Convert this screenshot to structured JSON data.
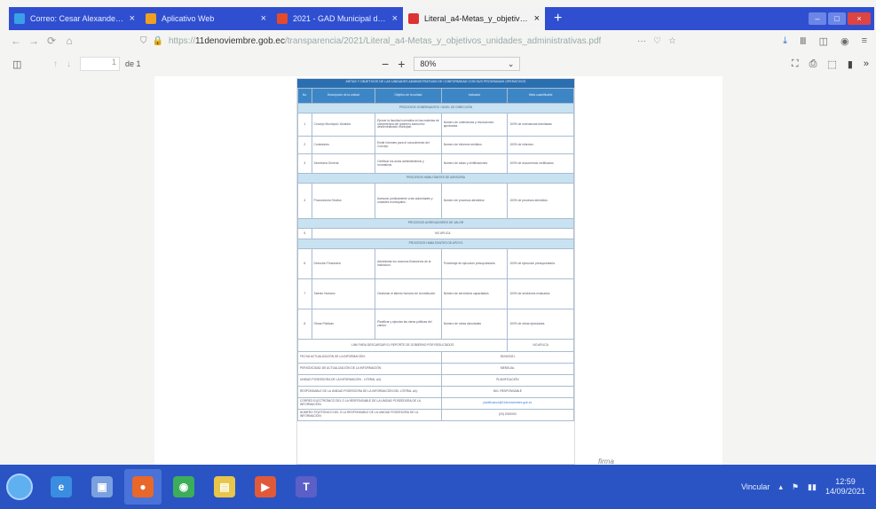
{
  "tabs": [
    {
      "title": "Correo: Cesar Alexander Grijalva",
      "active": false,
      "favicon_color": "#3aa0e8"
    },
    {
      "title": "Aplicativo Web",
      "active": false,
      "favicon_color": "#f0a020"
    },
    {
      "title": "2021 - GAD Municipal de 11 de",
      "active": false,
      "favicon_color": "#e34b2b"
    },
    {
      "title": "Literal_a4-Metas_y_objetivos_unid",
      "active": true,
      "favicon_color": "#d33"
    }
  ],
  "url": {
    "host": "11denoviembre.gob.ec",
    "path": "/transparencia/2021/Literal_a4-Metas_y_objetivos_unidades_administrativas.pdf"
  },
  "pdf": {
    "page_number": "1",
    "page_count": "de 1",
    "zoom": "80%"
  },
  "document": {
    "header": "METAS Y OBJETIVOS DE LAS UNIDADES ADMINISTRATIVAS DE CONFORMIDAD CON SUS PROGRAMAS OPERATIVOS",
    "columns": [
      "No.",
      "Descripción de la unidad",
      "Objetivo de la unidad",
      "Indicador",
      "Meta cuantificable"
    ],
    "sections": [
      {
        "title": "PROCESOS GOBERNANTES / NIVEL DE DIRECCIÓN",
        "rows": [
          {
            "num": "1",
            "unit": "Concejo Municipal / Alcaldía",
            "objective": "Ejercer la facultad normativa en las materias de competencia del gobierno autónomo descentralizado municipal.",
            "indicator": "Número de ordenanzas y resoluciones aprobadas",
            "goal": "100% de ordenanzas tramitadas"
          },
          {
            "num": "2",
            "unit": "Comisiones",
            "objective": "Emitir informes para el conocimiento del Concejo.",
            "indicator": "Número de informes emitidos",
            "goal": "100% de informes"
          },
          {
            "num": "3",
            "unit": "Secretaría General",
            "objective": "Certificar los actos administrativos y normativos.",
            "indicator": "Número de actas y certificaciones",
            "goal": "100% de documentos certificados"
          }
        ]
      },
      {
        "title": "PROCESOS HABILITANTES DE ASESORÍA",
        "rows": [
          {
            "num": "4",
            "unit": "Procuraduría Síndica",
            "objective": "Asesorar jurídicamente a las autoridades y unidades municipales.",
            "indicator": "Número de procesos atendidos",
            "goal": "100% de procesos atendidos"
          }
        ]
      },
      {
        "title": "PROCESOS AGREGADORES DE VALOR",
        "rows": [
          {
            "num": "5",
            "unit": "",
            "objective": "NO APLICA",
            "indicator": "",
            "goal": ""
          }
        ]
      },
      {
        "title": "PROCESOS HABILITANTES DE APOYO",
        "rows": [
          {
            "num": "6",
            "unit": "Dirección Financiera",
            "objective": "Administrar los recursos financieros de la institución.",
            "indicator": "Porcentaje de ejecución presupuestaria",
            "goal": "100% de ejecución presupuestaria"
          },
          {
            "num": "7",
            "unit": "Talento Humano",
            "objective": "Gestionar el talento humano de la institución.",
            "indicator": "Número de servidores capacitados",
            "goal": "100% de servidores evaluados"
          },
          {
            "num": "8",
            "unit": "Obras Públicas",
            "objective": "Planificar y ejecutar las obras públicas del cantón.",
            "indicator": "Número de obras ejecutadas",
            "goal": "100% de obras ejecutadas"
          }
        ]
      }
    ],
    "report_note": "LINK PARA DESCARGAR EL REPORTE DE GOBIERNO POR RESULTADOS",
    "report_value": "NO APLICA",
    "footer_rows": [
      {
        "label": "FECHA ACTUALIZACIÓN DE LA INFORMACIÓN:",
        "value": "30/06/2021"
      },
      {
        "label": "PERIODICIDAD DE ACTUALIZACIÓN DE LA INFORMACIÓN:",
        "value": "MENSUAL"
      },
      {
        "label": "UNIDAD POSEEDORA DE LA INFORMACIÓN - LITERAL a4):",
        "value": "PLANIFICACIÓN"
      },
      {
        "label": "RESPONSABLE DE LA UNIDAD POSEEDORA DE LA INFORMACIÓN DEL LITERAL a4):",
        "value": "ING. RESPONSABLE"
      },
      {
        "label": "CORREO ELECTRÓNICO DEL O LA RESPONSABLE DE LA UNIDAD POSEEDORA DE LA INFORMACIÓN:",
        "value": "planificacion@11denoviembre.gob.ec"
      },
      {
        "label": "NÚMERO TELEFÓNICO DEL O LA RESPONSABLE DE LA UNIDAD POSEEDORA DE LA INFORMACIÓN:",
        "value": "(03) 2000000"
      }
    ],
    "signature": "firma"
  },
  "taskbar": {
    "apps": [
      {
        "name": "ie",
        "label": "e",
        "color": "#3a8de0",
        "active": false
      },
      {
        "name": "explorer-window",
        "label": "▣",
        "color": "#7aa0e0",
        "active": false
      },
      {
        "name": "firefox",
        "label": "●",
        "color": "#e8672a",
        "active": true
      },
      {
        "name": "chrome",
        "label": "◉",
        "color": "#3cae5a",
        "active": false
      },
      {
        "name": "folder",
        "label": "▤",
        "color": "#e8c64a",
        "active": false
      },
      {
        "name": "media",
        "label": "▶",
        "color": "#e05a3a",
        "active": false
      },
      {
        "name": "teams",
        "label": "T",
        "color": "#5b5fc7",
        "active": false
      }
    ],
    "language": "Vincular",
    "time": "12:59",
    "date": "14/09/2021"
  }
}
